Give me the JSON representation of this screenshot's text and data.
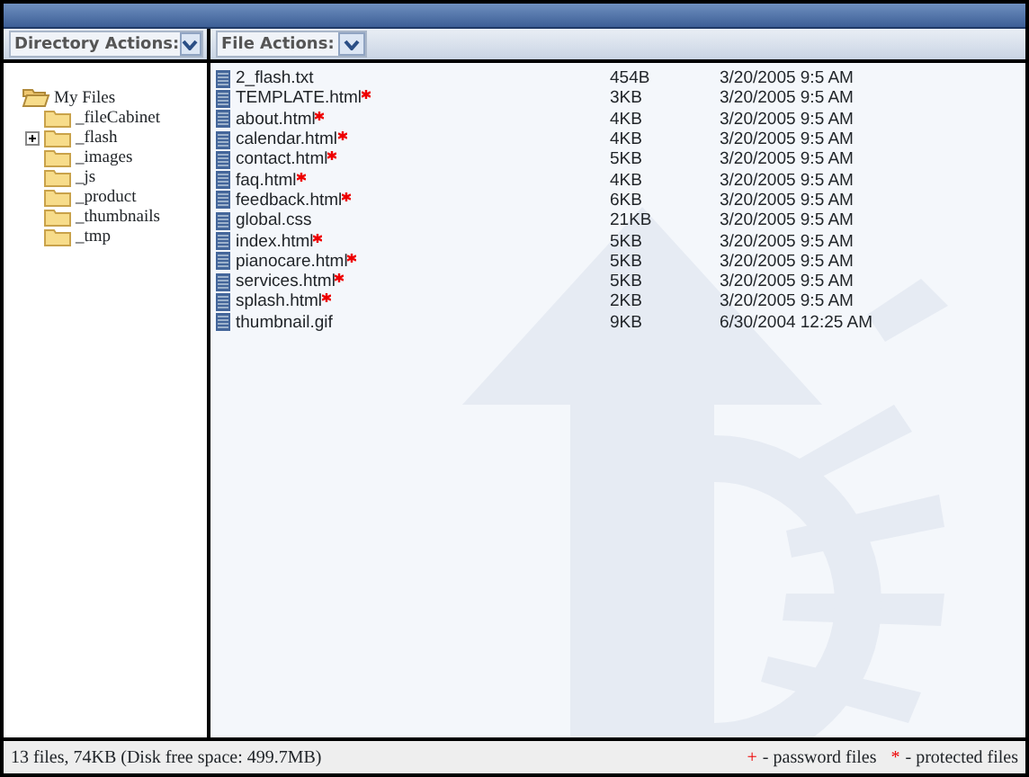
{
  "toolbar": {
    "directory_actions": "Directory Actions:",
    "file_actions": "File Actions:"
  },
  "tree": [
    {
      "name": "My Files",
      "expanded": true,
      "children": [
        {
          "name": "_fileCabinet",
          "collapsed": false
        },
        {
          "name": "_flash",
          "collapsed": true
        },
        {
          "name": "_images",
          "collapsed": false
        },
        {
          "name": "_js",
          "collapsed": false
        },
        {
          "name": "_product",
          "collapsed": false
        },
        {
          "name": "_thumbnails",
          "collapsed": false
        },
        {
          "name": "_tmp",
          "collapsed": false
        }
      ]
    }
  ],
  "files": [
    {
      "name": "2_flash.txt",
      "protected": false,
      "size": "454B",
      "date": "3/20/2005 9:5 AM"
    },
    {
      "name": "TEMPLATE.html",
      "protected": true,
      "size": "3KB",
      "date": "3/20/2005 9:5 AM"
    },
    {
      "name": "about.html",
      "protected": true,
      "size": "4KB",
      "date": "3/20/2005 9:5 AM"
    },
    {
      "name": "calendar.html",
      "protected": true,
      "size": "4KB",
      "date": "3/20/2005 9:5 AM"
    },
    {
      "name": "contact.html",
      "protected": true,
      "size": "5KB",
      "date": "3/20/2005 9:5 AM"
    },
    {
      "name": "faq.html",
      "protected": true,
      "size": "4KB",
      "date": "3/20/2005 9:5 AM"
    },
    {
      "name": "feedback.html",
      "protected": true,
      "size": "6KB",
      "date": "3/20/2005 9:5 AM"
    },
    {
      "name": "global.css",
      "protected": false,
      "size": "21KB",
      "date": "3/20/2005 9:5 AM"
    },
    {
      "name": "index.html",
      "protected": true,
      "size": "5KB",
      "date": "3/20/2005 9:5 AM"
    },
    {
      "name": "pianocare.html",
      "protected": true,
      "size": "5KB",
      "date": "3/20/2005 9:5 AM"
    },
    {
      "name": "services.html",
      "protected": true,
      "size": "5KB",
      "date": "3/20/2005 9:5 AM"
    },
    {
      "name": "splash.html",
      "protected": true,
      "size": "2KB",
      "date": "3/20/2005 9:5 AM"
    },
    {
      "name": "thumbnail.gif",
      "protected": false,
      "size": "9KB",
      "date": "6/30/2004 12:25 AM"
    }
  ],
  "status_bar": {
    "summary": "13 files, 74KB (Disk free space: 499.7MB)",
    "legend": [
      {
        "symbol": "+",
        "text": "- password files"
      },
      {
        "symbol": "*",
        "text": "- protected files"
      }
    ]
  }
}
